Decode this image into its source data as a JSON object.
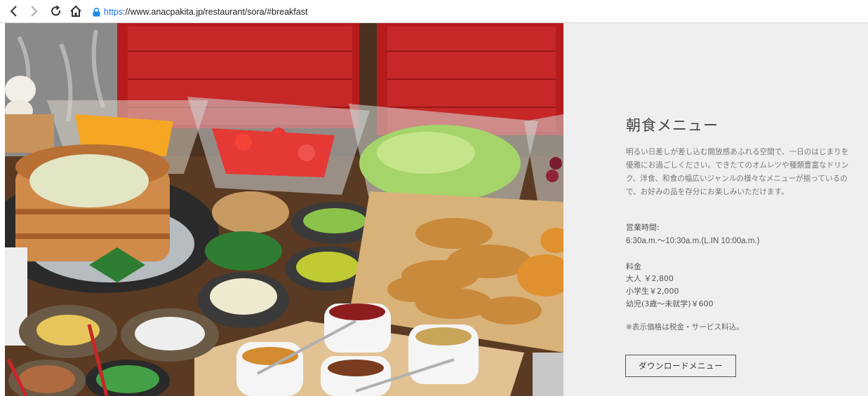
{
  "browser": {
    "url_scheme": "https",
    "url_rest": "://www.anacpakita.jp/restaurant/sora/#breakfast",
    "icons": [
      "back-arrow-icon",
      "forward-arrow-icon",
      "reload-icon",
      "home-icon",
      "lock-icon"
    ]
  },
  "photo": {
    "subject": "breakfast-buffet-image"
  },
  "menu": {
    "title": "朝食メニュー",
    "description": "明るい日差しが差し込む開放感あふれる空間で、一日のはじまりを優雅にお過ごしください。できたてのオムレツや種類豊富なドリンク、洋食、和食の幅広いジャンルの様々なメニューが揃っているので、お好みの品を存分にお楽しみいただけます。",
    "hours_label": "営業時間:",
    "hours_value": "6:30a.m.〜10:30a.m.(L.IN 10:00a.m.)",
    "price_label": "料金",
    "prices": [
      "大人 ￥2,800",
      "小学生￥2,000",
      "幼児(3歳〜未就学)￥600"
    ],
    "note": "※表示価格は税金・サービス料込。",
    "download_label": "ダウンロードメニュー"
  },
  "colors": {
    "panel_bg": "#f0efef",
    "link_blue": "#1a73e8",
    "lock_blue": "#1e88e5"
  }
}
